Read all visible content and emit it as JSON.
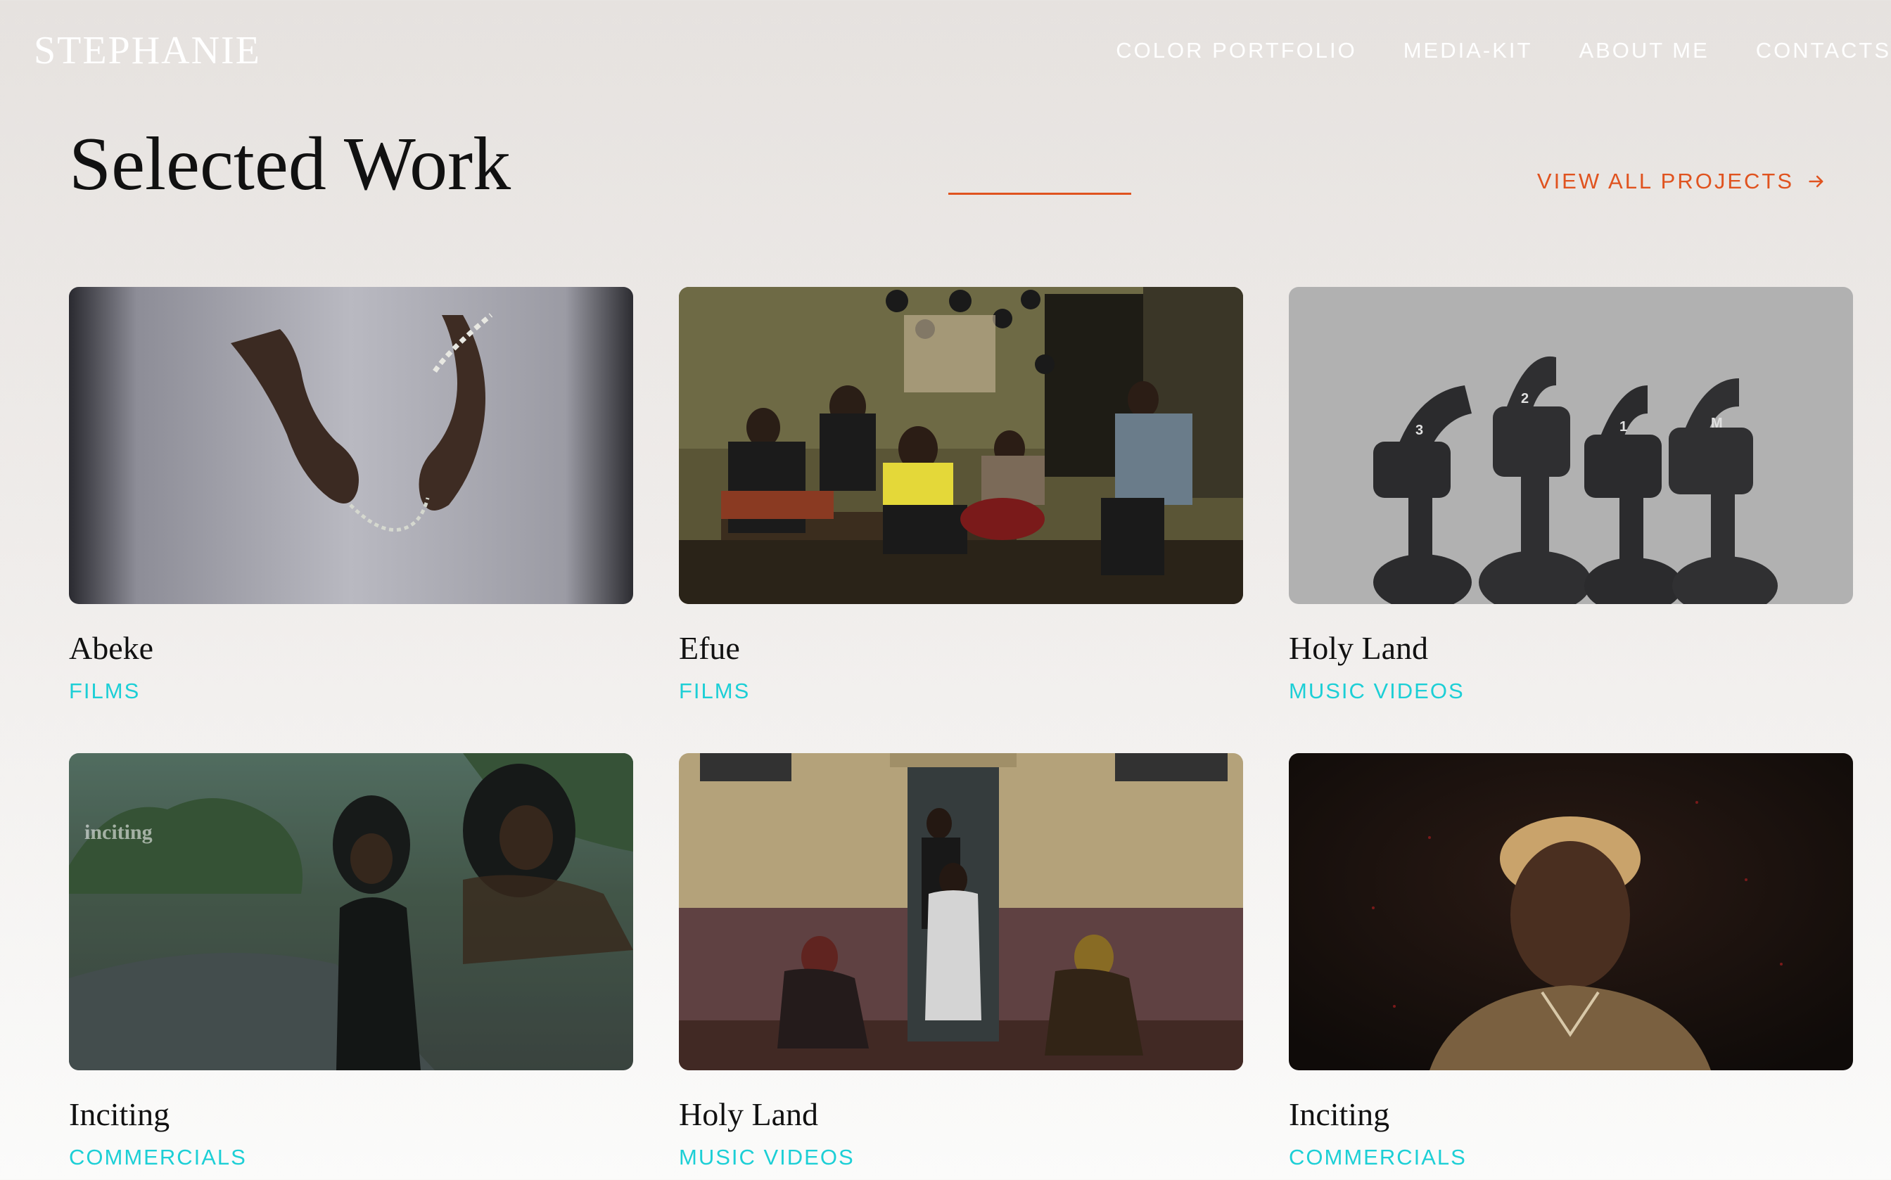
{
  "header": {
    "brand": "STEPHANIE",
    "nav": [
      {
        "label": "COLOR PORTFOLIO"
      },
      {
        "label": "MEDIA-KIT"
      },
      {
        "label": "ABOUT ME"
      },
      {
        "label": "CONTACTS"
      }
    ]
  },
  "section": {
    "title": "Selected Work",
    "view_all_label": "VIEW ALL PROJECTS",
    "accent_color": "#e0531f",
    "category_color": "#1ccfd6"
  },
  "projects": [
    {
      "title": "Abeke",
      "category": "FILMS",
      "image": "hands-holding-rosary"
    },
    {
      "title": "Efue",
      "category": "FILMS",
      "image": "band-performing-in-room"
    },
    {
      "title": "Holy Land",
      "category": "MUSIC VIDEOS",
      "image": "headset-microphones"
    },
    {
      "title": "Inciting",
      "category": "COMMERCIALS",
      "image": "two-women-on-road",
      "overlay_text": "inciting"
    },
    {
      "title": "Holy Land",
      "category": "MUSIC VIDEOS",
      "image": "women-at-doorway"
    },
    {
      "title": "Inciting",
      "category": "COMMERCIALS",
      "image": "man-portrait-dark"
    }
  ]
}
